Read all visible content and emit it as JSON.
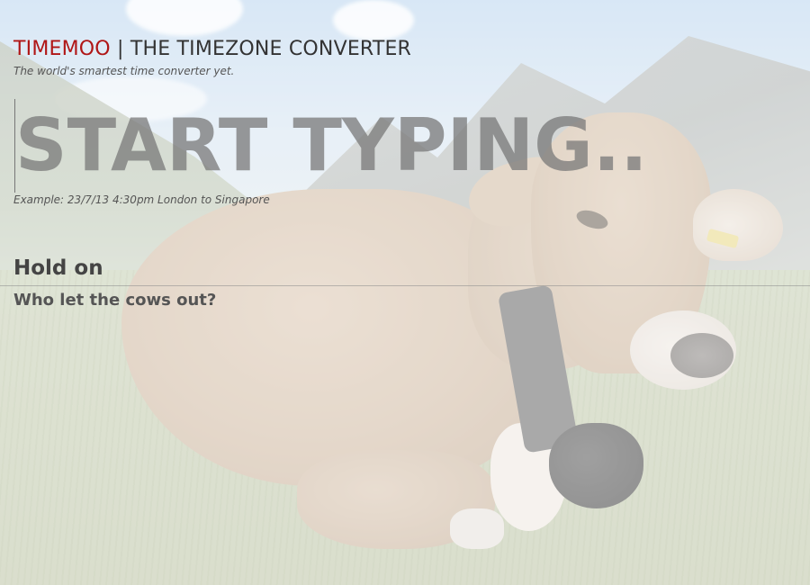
{
  "header": {
    "brand_name": "TIMEMOO",
    "separator": " | ",
    "title": "THE TIMEZONE CONVERTER",
    "tagline": "The world's smartest time converter yet."
  },
  "input": {
    "placeholder": "START TYPING...",
    "value": ""
  },
  "example": {
    "text": "Example: 23/7/13 4:30pm London to Singapore"
  },
  "result": {
    "heading": "Hold on",
    "subheading": "Who let the cows out?"
  },
  "colors": {
    "brand_red": "#b01616",
    "text_dark": "#333333",
    "placeholder_gray": "#787878"
  }
}
